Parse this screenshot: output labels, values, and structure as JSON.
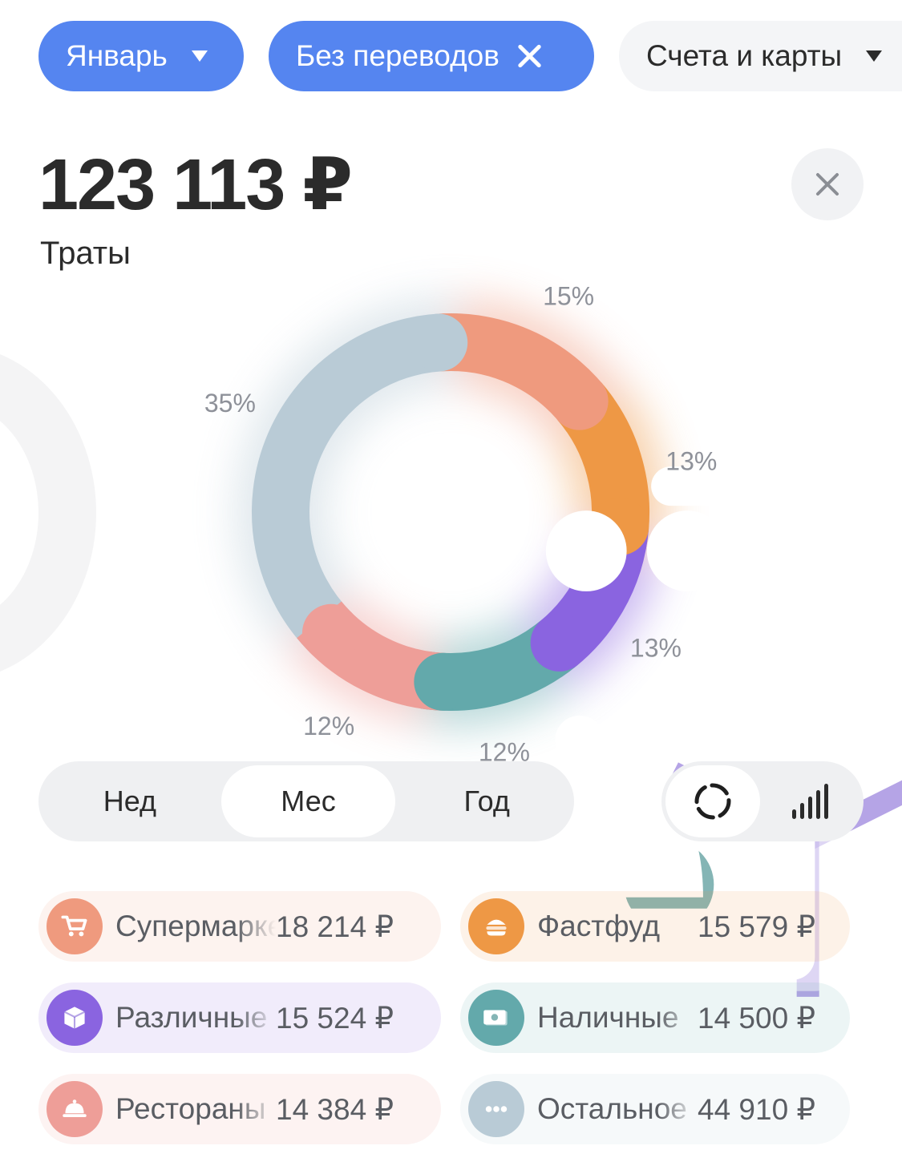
{
  "filters": {
    "month": "Январь",
    "no_transfers": "Без переводов",
    "accounts": "Счета и карты"
  },
  "summary": {
    "total": "123 113 ₽",
    "label": "Траты"
  },
  "chart_data": {
    "type": "pie",
    "labels": [
      "Супермаркеты",
      "Фастфуд",
      "Различные товары",
      "Наличные",
      "Рестораны",
      "Остальное"
    ],
    "values": [
      18214,
      15579,
      15524,
      14500,
      14384,
      44910
    ],
    "percent_labels": [
      "15%",
      "13%",
      "13%",
      "12%",
      "12%",
      "35%"
    ],
    "colors": [
      "#ef9a7e",
      "#ee9845",
      "#8a64e0",
      "#63a9ab",
      "#ee9e98",
      "#b9cbd6"
    ],
    "icons": [
      "cart-icon",
      "burger-icon",
      "box-icon",
      "cash-icon",
      "cloche-icon",
      "dots-icon"
    ]
  },
  "period": {
    "week": "Нед",
    "month": "Мес",
    "year": "Год",
    "selected": "Мес"
  },
  "view_toggle": {
    "options": [
      "donut-icon",
      "bars-icon"
    ],
    "selected": "donut-icon"
  },
  "categories": [
    {
      "name": "Супермаркеты",
      "amount": "18 214 ₽",
      "color": "#ef9a7e",
      "icon": "cart-icon"
    },
    {
      "name": "Фастфуд",
      "amount": "15 579 ₽",
      "color": "#ee9845",
      "icon": "burger-icon"
    },
    {
      "name": "Различные товары",
      "amount": "15 524 ₽",
      "color": "#8a64e0",
      "icon": "box-icon"
    },
    {
      "name": "Наличные",
      "amount": "14 500 ₽",
      "color": "#63a9ab",
      "icon": "cash-icon"
    },
    {
      "name": "Рестораны",
      "amount": "14 384 ₽",
      "color": "#ee9e98",
      "icon": "cloche-icon"
    },
    {
      "name": "Остальное",
      "amount": "44 910 ₽",
      "color": "#b9cbd6",
      "icon": "dots-icon"
    }
  ]
}
